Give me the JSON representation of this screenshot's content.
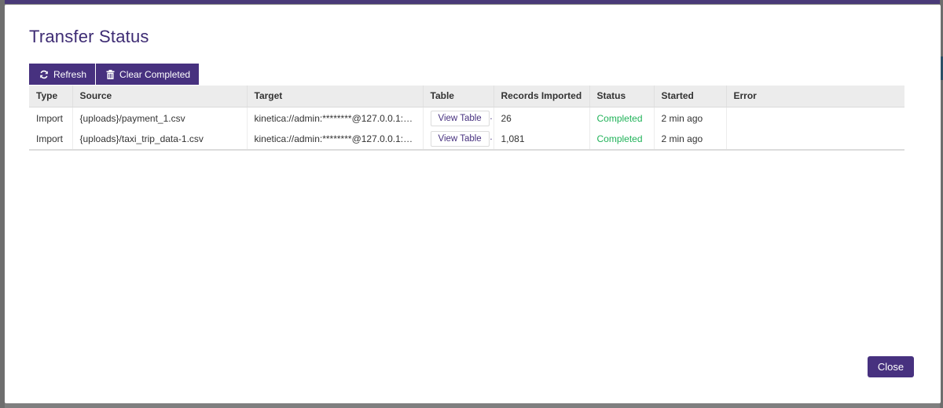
{
  "modal": {
    "title": "Transfer Status",
    "close_label": "Close"
  },
  "toolbar": {
    "refresh_label": "Refresh",
    "refresh_icon": "refresh-icon",
    "clear_label": "Clear Completed",
    "clear_icon": "trash-icon"
  },
  "table": {
    "columns": [
      "Type",
      "Source",
      "Target",
      "Table",
      "Records Imported",
      "Status",
      "Started",
      "Error"
    ],
    "rows": [
      {
        "type": "Import",
        "source": "{uploads}/payment_1.csv",
        "target": "kinetica://admin:********@127.0.0.1:9…",
        "table_action": "View Table",
        "records": "26",
        "status": "Completed",
        "started": "2 min ago",
        "error": ""
      },
      {
        "type": "Import",
        "source": "{uploads}/taxi_trip_data-1.csv",
        "target": "kinetica://admin:********@127.0.0.1:9…",
        "table_action": "View Table",
        "records": "1,081",
        "status": "Completed",
        "started": "2 min ago",
        "error": ""
      }
    ]
  },
  "colors": {
    "primary": "#47317f",
    "title": "#3d2b73",
    "status_completed": "#22b35a"
  }
}
